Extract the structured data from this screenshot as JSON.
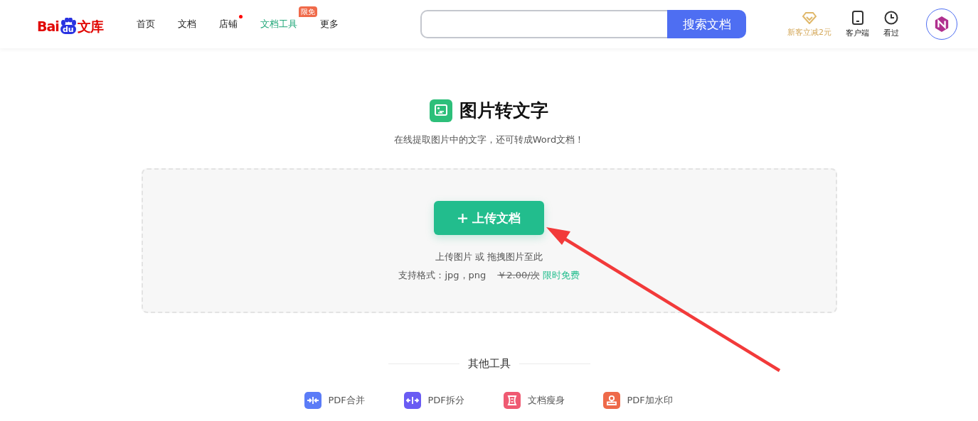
{
  "header": {
    "logo": {
      "latin": "Bai",
      "paw": "du",
      "cn": "文库"
    },
    "nav": [
      {
        "label": "首页",
        "selected": false
      },
      {
        "label": "文档",
        "selected": false
      },
      {
        "label": "店铺",
        "selected": false,
        "dot": true
      },
      {
        "label": "文档工具",
        "selected": true,
        "badge": "限免"
      },
      {
        "label": "更多",
        "selected": false
      }
    ],
    "search": {
      "button": "搜索文档"
    },
    "actions": [
      {
        "kind": "promo",
        "label": "新客立减2元"
      },
      {
        "kind": "client",
        "label": "客户端"
      },
      {
        "kind": "history",
        "label": "看过"
      }
    ]
  },
  "tool": {
    "title": "图片转文字",
    "subtitle": "在线提取图片中的文字，还可转成Word文档！",
    "upload": {
      "button": "上传文档",
      "hint": "上传图片 或 拖拽图片至此",
      "formats": "支持格式：jpg，png",
      "old_price": "￥2.00/次",
      "offer": "限时免费"
    }
  },
  "other_tools": {
    "heading": "其他工具",
    "items": [
      {
        "kind": "merge",
        "label": "PDF合并",
        "color": "#5b7cf7"
      },
      {
        "kind": "split",
        "label": "PDF拆分",
        "color": "#6a5cf3"
      },
      {
        "kind": "slim",
        "label": "文档瘦身",
        "color": "#ef5a72"
      },
      {
        "kind": "stamp",
        "label": "PDF加水印",
        "color": "#ee6a4a"
      }
    ]
  }
}
